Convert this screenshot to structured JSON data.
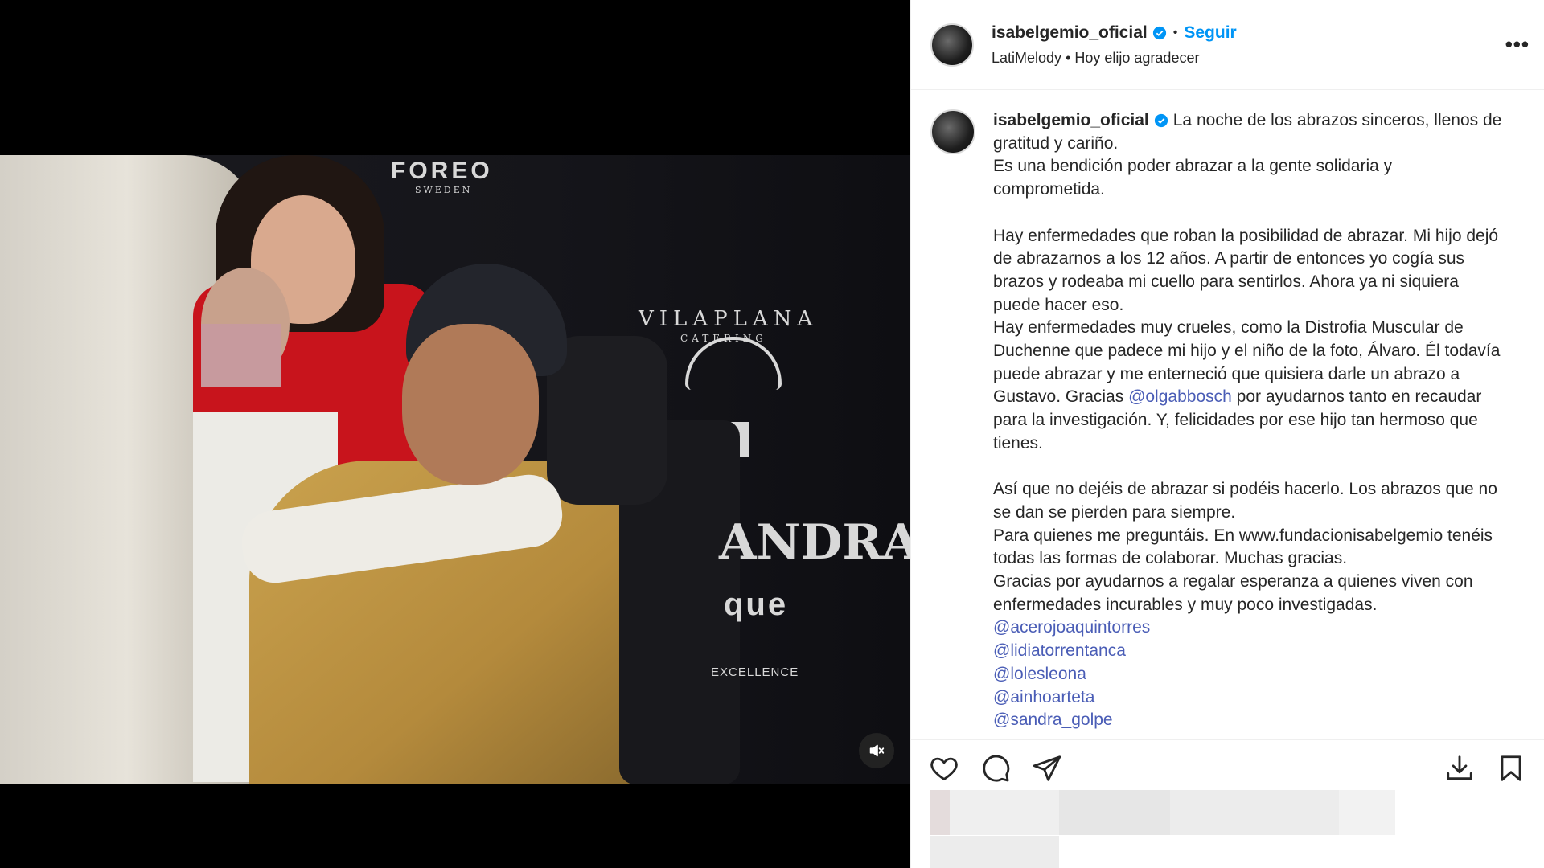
{
  "post": {
    "username": "isabelgemio_oficial",
    "follow_label": "Seguir",
    "audio_artist": "LatiMelody",
    "audio_track": "Hoy elijo agradecer",
    "more_label": "•••"
  },
  "media": {
    "backdrop": {
      "foreo": "FOREO",
      "sweden": "SWEDEN",
      "vilaplana": "VILAPLANA",
      "catering": "CATERING",
      "andra": "ANDRA",
      "que": "que",
      "excellence": "EXCELLENCE"
    }
  },
  "caption": {
    "p1": "La noche de los abrazos sinceros, llenos de gratitud y cariño.",
    "p2": "Es una bendición poder abrazar a la gente solidaria y comprometida.",
    "p3": "Hay enfermedades que roban la posibilidad de abrazar. Mi hijo dejó de abrazarnos a los 12 años. A partir de entonces yo cogía sus brazos y rodeaba mi cuello para sentirlos. Ahora ya ni siquiera puede hacer eso.",
    "p4a": "Hay enfermedades muy crueles, como la Distrofia Muscular de Duchenne que padece mi hijo y el niño de la foto, Álvaro. Él todavía puede abrazar y me enterneció que quisiera darle un abrazo a Gustavo. Gracias ",
    "p4_mention": "@olgabbosch",
    "p4b": " por ayudarnos tanto en recaudar para la investigación. Y, felicidades por ese hijo tan hermoso que tienes.",
    "p5": "Así que no dejéis de abrazar si podéis hacerlo. Los abrazos que no se dan se pierden para siempre.",
    "p6": "Para quienes me preguntáis. En www.fundacionisabelgemio tenéis todas las formas de colaborar. Muchas gracias.",
    "p7": "Gracias por ayudarnos a regalar esperanza a quienes viven con enfermedades incurables y muy poco investigadas.",
    "mentions": [
      "@acerojoaquintorres",
      "@lidiatorrentanca",
      "@lolesleona",
      "@ainhoarteta",
      "@sandra_golpe"
    ]
  },
  "icons": [
    "heart-icon",
    "comment-icon",
    "share-icon",
    "download-icon",
    "bookmark-icon",
    "mute-icon",
    "verified-icon"
  ],
  "colors": {
    "follow": "#0095f6",
    "mention": "#4a5db6",
    "verified": "#0095f6",
    "dress": "#c8141c"
  }
}
